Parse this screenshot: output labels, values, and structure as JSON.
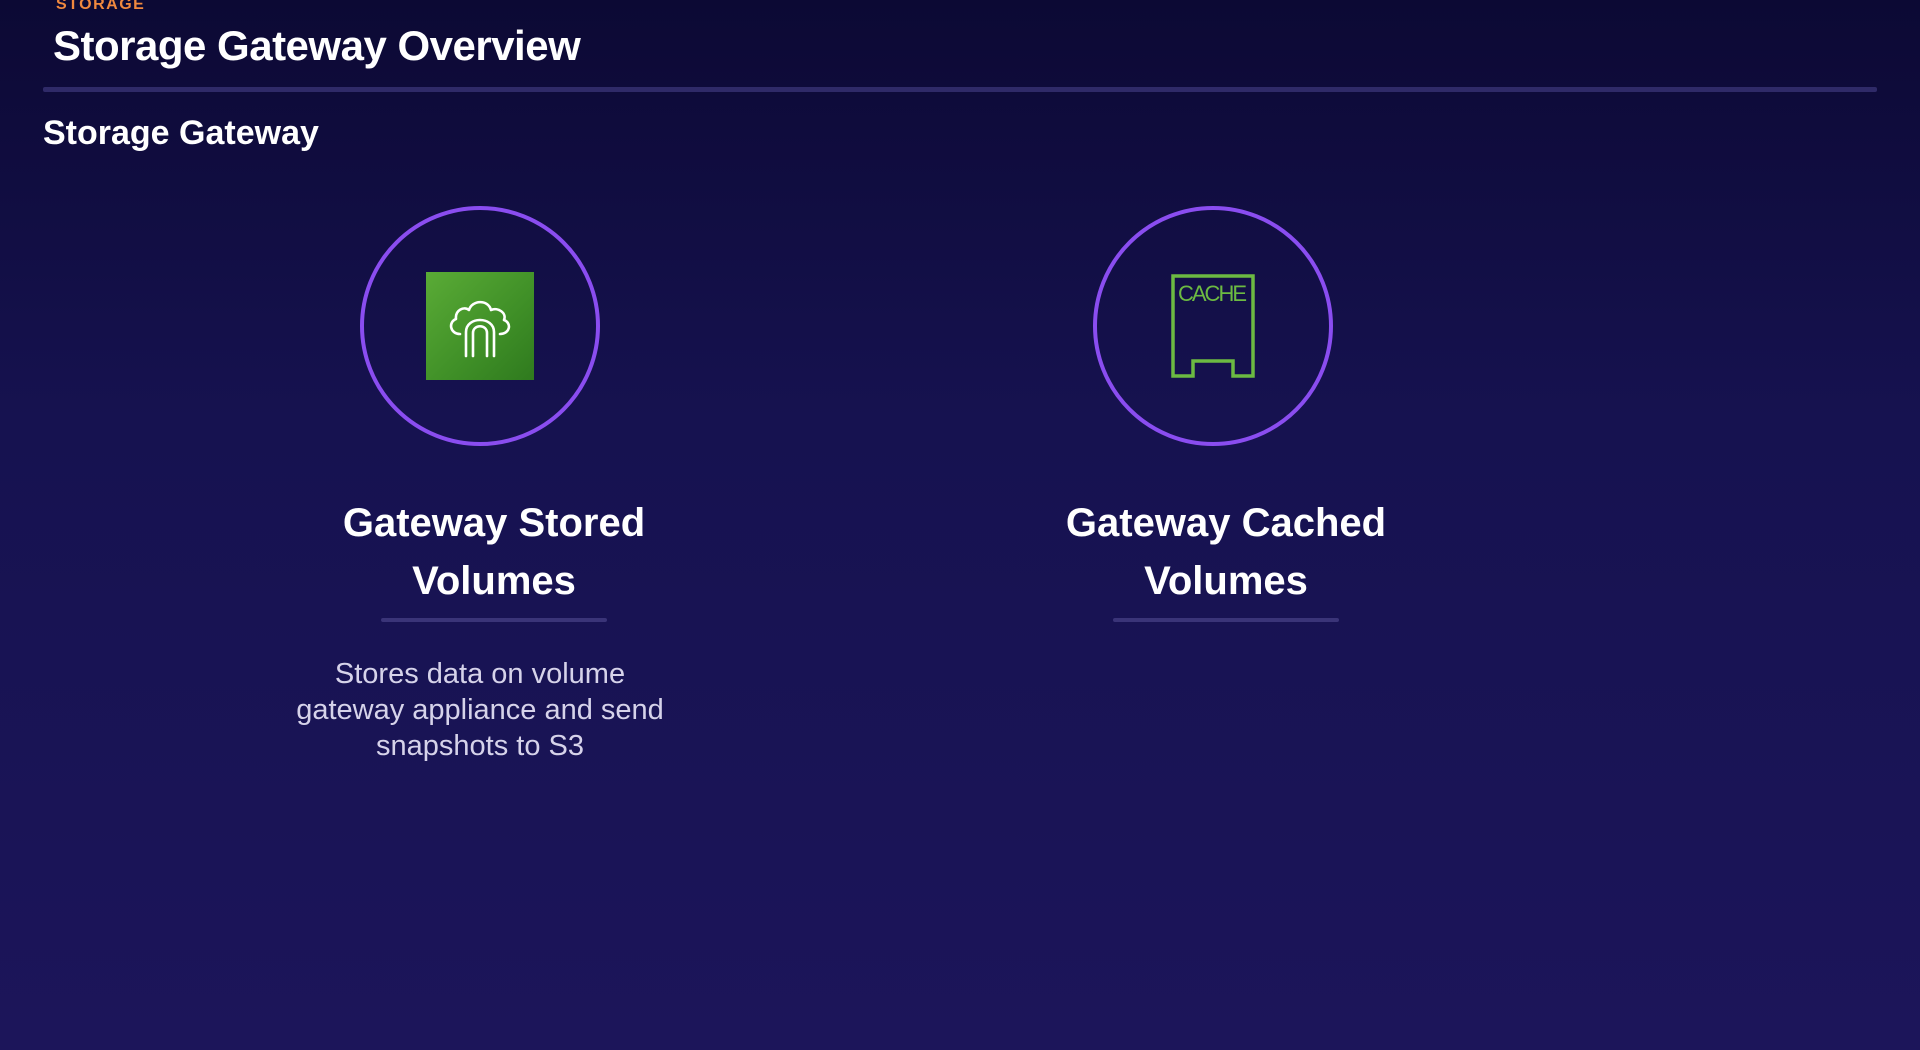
{
  "header": {
    "category": "STORAGE",
    "title": "Storage Gateway Overview"
  },
  "section": {
    "title": "Storage Gateway"
  },
  "cards": [
    {
      "title_line1": "Gateway Stored",
      "title_line2": "Volumes",
      "description_line1": "Stores data on volume",
      "description_line2": "gateway appliance and send",
      "description_line3": "snapshots to S3",
      "icon": "storage-gateway-icon"
    },
    {
      "title_line1": "Gateway Cached",
      "title_line2": "Volumes",
      "icon_label": "CACHE",
      "icon": "cache-icon"
    }
  ],
  "colors": {
    "accent_orange": "#f0883e",
    "ring_purple": "#8a4df0",
    "aws_green": "#3f8f27",
    "cache_green": "#6cba42",
    "background": "#161250"
  }
}
